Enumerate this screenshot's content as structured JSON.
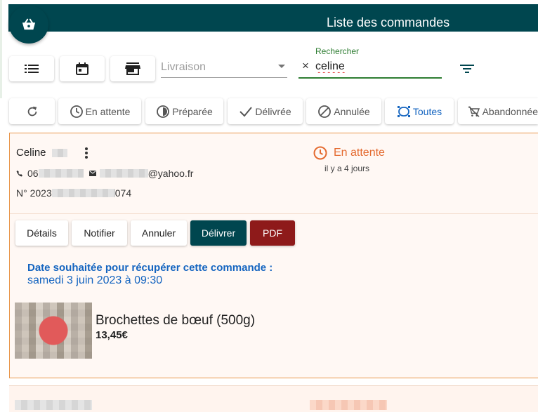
{
  "header": {
    "title": "Liste des commandes"
  },
  "fab": {
    "icon": "basket-icon"
  },
  "toolbar": {
    "view_buttons": [
      {
        "icon": "list-icon"
      },
      {
        "icon": "calendar-icon"
      },
      {
        "icon": "store-icon"
      }
    ],
    "delivery_select": {
      "value": "Livraison"
    },
    "search": {
      "label": "Rechercher",
      "value": "celine",
      "clear_icon": "×"
    },
    "filter_icon": "filter-icon"
  },
  "status_filters": {
    "refresh_icon": "refresh-icon",
    "items": [
      {
        "label": "En attente",
        "icon": "clock-icon"
      },
      {
        "label": "Préparée",
        "icon": "half-circle-icon"
      },
      {
        "label": "Délivrée",
        "icon": "check-icon"
      },
      {
        "label": "Annulée",
        "icon": "block-icon"
      },
      {
        "label": "Toutes",
        "icon": "select-all-icon",
        "active": true
      },
      {
        "label": "Abandonnée",
        "icon": "cart-off-icon"
      }
    ]
  },
  "order": {
    "customer_name": "Celine",
    "phone_prefix": "06",
    "email_suffix": "@yahoo.fr",
    "order_prefix": "N° 2023",
    "order_suffix": "074",
    "status": {
      "label": "En attente",
      "time": "il y a 4 jours",
      "color": "#e46a2f"
    },
    "actions": [
      "Détails",
      "Notifier",
      "Annuler",
      "Délivrer",
      "PDF"
    ],
    "pickup": {
      "label": "Date souhaitée pour récupérer cette commande :",
      "value": "samedi 3 juin 2023 à 09:30"
    },
    "product": {
      "name": "Brochettes de bœuf (500g)",
      "price": "13,45€"
    }
  },
  "colors": {
    "primary": "#00464f",
    "accent_blue": "#1565c0",
    "pending": "#e46a2f",
    "pdf": "#8e1a1a"
  }
}
